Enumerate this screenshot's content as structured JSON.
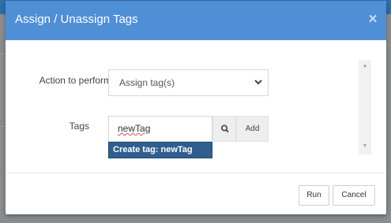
{
  "modal": {
    "title": "Assign / Unassign Tags",
    "close_icon": "close-icon"
  },
  "form": {
    "action_label": "Action to perform",
    "action_value": "Assign tag(s)",
    "tags_label": "Tags",
    "tags_input_value": "newTag",
    "search_icon": "search-icon",
    "add_label": "Add",
    "suggestion": "Create tag: newTag"
  },
  "footer": {
    "run_label": "Run",
    "cancel_label": "Cancel"
  },
  "colors": {
    "header": "#4f8fd6",
    "suggestion_bg": "#2f5f8f",
    "overlay": "#7b7e81"
  }
}
